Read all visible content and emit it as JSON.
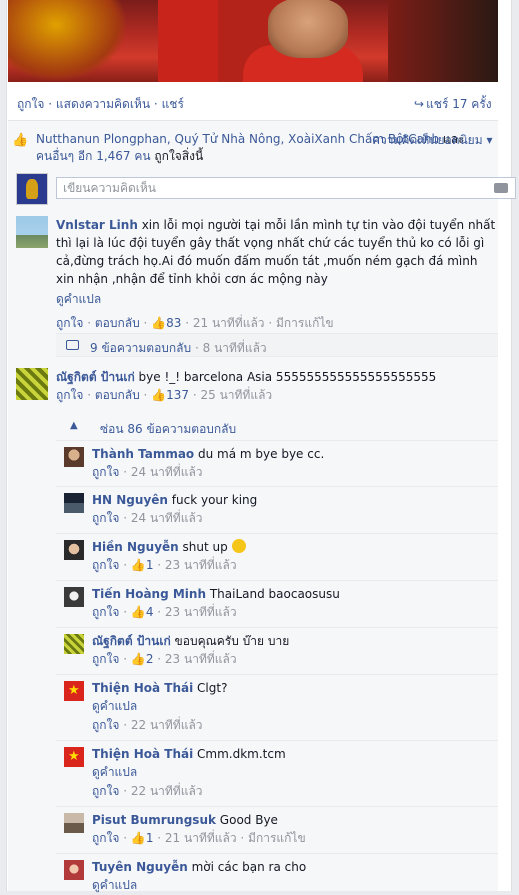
{
  "post_actions": {
    "like": "ถูกใจ",
    "comment": "แสดงความคิดเห็น",
    "share": "แชร์",
    "sep": "·",
    "share_count": "แชร์ 17 ครั้ง"
  },
  "likes_summary": {
    "names": "Nutthanun Plongphan, Quý Tử Nhà Nông, XoàiXanh Chấm BộtCanh",
    "and_text": " และ ",
    "others": "คนอื่นๆ อีก 1,467 คน",
    "liked_text": " ถูกใจสิ่งนี้",
    "top_comments": "ความคิดเห็นยอดนิยม ▾"
  },
  "composer": {
    "placeholder": "เขียนความคิดเห็น"
  },
  "comments": [
    {
      "name": "Vnlstar Linh",
      "text": "xin lỗi mọi người tại mỗi lần mình tự tin vào đội tuyển nhất thì lại là lúc đội tuyển gây thất vọng nhất chứ các tuyển thủ ko có lỗi gì cả,đừng trách họ.Ai đó muốn đấm muốn tát ,muốn ném gạch đá mình xin nhận ,nhận để tỉnh khỏi cơn ác mộng này",
      "translate": "ดูคำแปล",
      "like": "ถูกใจ",
      "reply": "ตอบกลับ",
      "likes": "83",
      "time": "21 นาทีที่แล้ว",
      "edited": "มีการแก้ไข"
    },
    {
      "name": "ณัฐกิตต์ ป้านเก่",
      "text": "bye !_! barcelona Asia 555555555555555555555",
      "like": "ถูกใจ",
      "reply": "ตอบกลับ",
      "likes": "137",
      "time": "25 นาทีที่แล้ว"
    }
  ],
  "replies_bar": {
    "count_text": "9 ข้อความตอบกลับ",
    "time": "8 นาทีที่แล้ว"
  },
  "hide_bar": {
    "text": "ซ่อน 86 ข้อความตอบกลับ"
  },
  "replies": [
    {
      "name": "Thành Tammao",
      "text": "du má m bye bye cc.",
      "like": "ถูกใจ",
      "time": "24 นาทีที่แล้ว"
    },
    {
      "name": "HN Nguyên",
      "text": "fuck your king",
      "like": "ถูกใจ",
      "time": "24 นาทีที่แล้ว"
    },
    {
      "name": "Hiền Nguyễn",
      "text": "shut up",
      "like": "ถูกใจ",
      "likes": "1",
      "time": "23 นาทีที่แล้ว"
    },
    {
      "name": "Tiến Hoàng Minh",
      "text": "ThaiLand baocaosusu",
      "like": "ถูกใจ",
      "likes": "4",
      "time": "23 นาทีที่แล้ว"
    },
    {
      "name": "ณัฐกิตต์ ป้านเก่",
      "text": "ขอบคุณครับ บ๊าย บาย",
      "like": "ถูกใจ",
      "likes": "2",
      "time": "23 นาทีที่แล้ว"
    },
    {
      "name": "Thiện Hoà Thái",
      "text": "Clgt?",
      "translate": "ดูคำแปล",
      "like": "ถูกใจ",
      "time": "22 นาทีที่แล้ว"
    },
    {
      "name": "Thiện Hoà Thái",
      "text": "Cmm.dkm.tcm",
      "translate": "ดูคำแปล",
      "like": "ถูกใจ",
      "time": "22 นาทีที่แล้ว"
    },
    {
      "name": "Pisut Bumrungsuk",
      "text": "Good Bye",
      "like": "ถูกใจ",
      "likes": "1",
      "time": "21 นาทีที่แล้ว",
      "edited": "มีการแก้ไข"
    },
    {
      "name": "Tuyên Nguyễn",
      "text": "mời các bạn ra cho",
      "translate": "ดูคำแปล"
    }
  ],
  "colors": {
    "link": "#3b5998",
    "meta": "#90949c",
    "ufi_bg": "#f6f7f9"
  },
  "icons": [
    "share-arrow-icon",
    "thumbs-up-icon",
    "camera-icon",
    "speech-bubble-icon",
    "chevron-up-icon",
    "smiley-emoji-icon"
  ]
}
